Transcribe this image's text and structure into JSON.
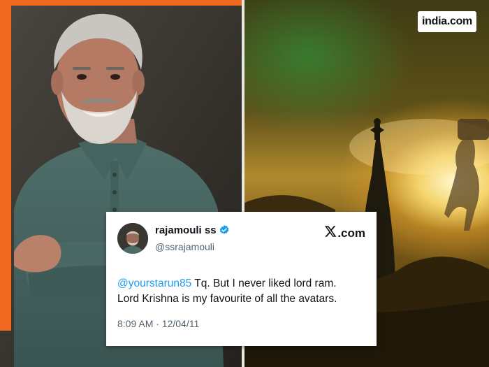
{
  "brand": {
    "logo_text": "india.com",
    "accent_color": "#f26a21"
  },
  "tweet": {
    "display_name": "rajamouli ss",
    "handle": "@ssrajamouli",
    "verified": true,
    "platform_label": ".com",
    "platform_icon": "x-logo-icon",
    "mention": "@yourstarun85",
    "text_line1": " Tq. But I never liked lord ram.",
    "text_line2": "Lord Krishna is my favourite of all the avatars.",
    "timestamp": "8:09 AM · 12/04/11"
  },
  "colors": {
    "verified_blue": "#1d9bf0",
    "handle_gray": "#536471",
    "text_dark": "#0f1419"
  }
}
